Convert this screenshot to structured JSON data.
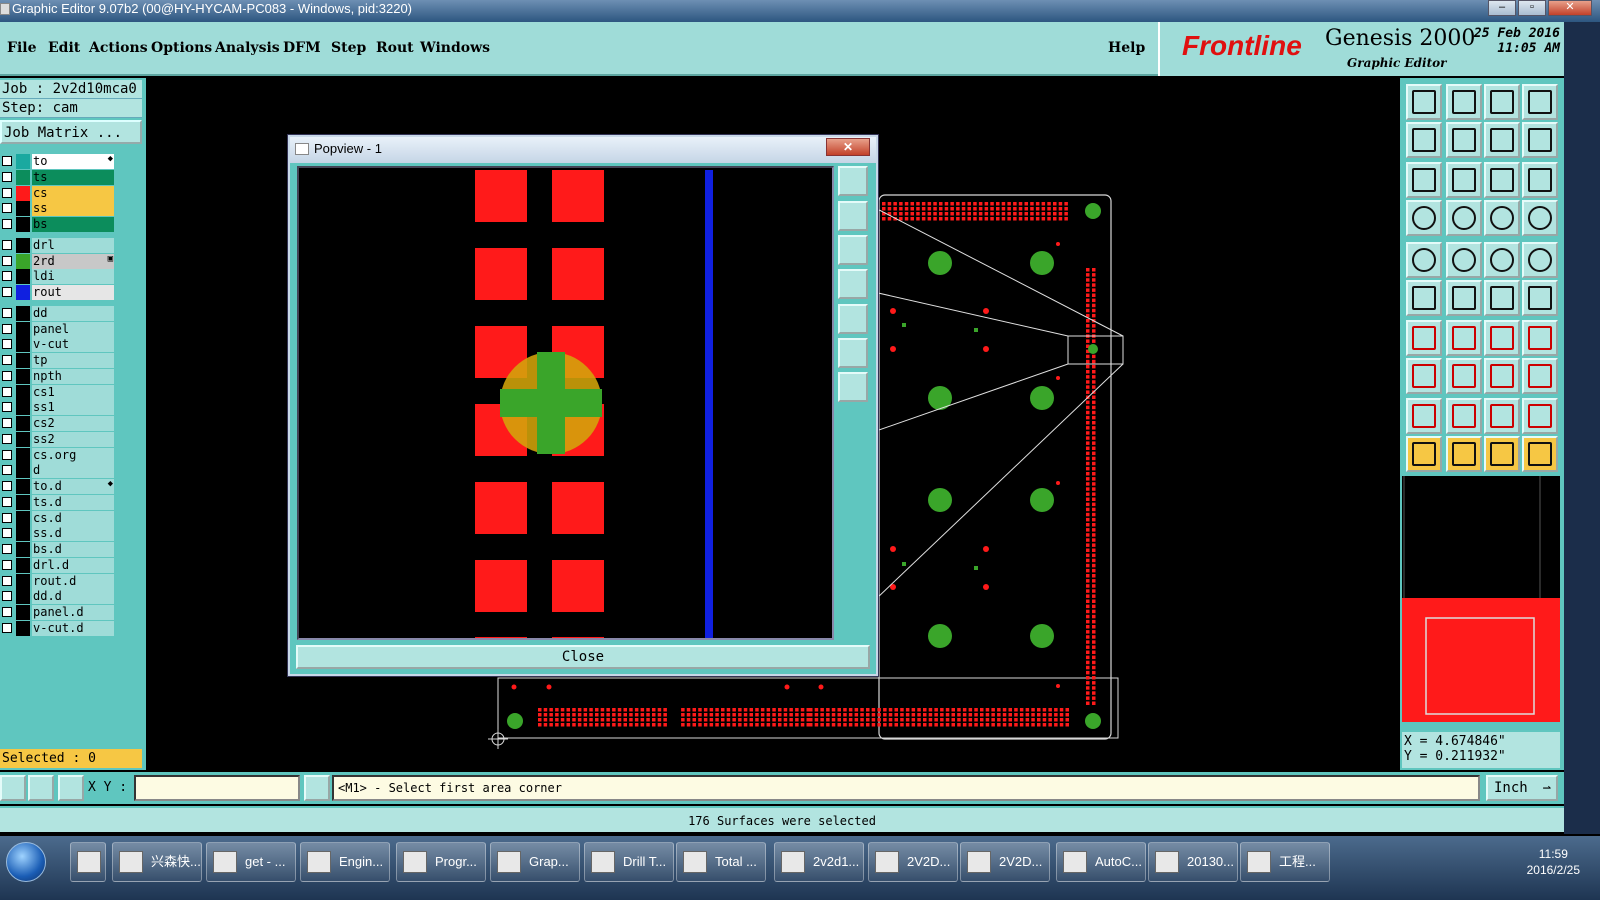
{
  "window": {
    "title": "Graphic Editor 9.07b2 (00@HY-HYCAM-PC083 - Windows, pid:3220)"
  },
  "menubar": {
    "items": [
      "File",
      "Edit",
      "Actions",
      "Options",
      "Analysis",
      "DFM",
      "Step",
      "Rout",
      "Windows"
    ],
    "help": "Help"
  },
  "brand": {
    "logo": "Frontline",
    "product": "Genesis 2000",
    "subtitle": "Graphic Editor",
    "date": "25 Feb 2016",
    "time": "11:05 AM"
  },
  "job": {
    "job_line": "Job : 2v2d10mca0",
    "step_line": "Step: cam",
    "matrix_button": "Job Matrix ..."
  },
  "layers": [
    {
      "name": "to",
      "color": "#1aa9a0",
      "bg": "#ffffff",
      "marker": "◆"
    },
    {
      "name": "ts",
      "color": "#0c8d5c",
      "bg": "#0c8d5c",
      "marker": ""
    },
    {
      "name": "cs",
      "color": "#ff1a1a",
      "bg": "#f6c744",
      "marker": ""
    },
    {
      "name": "ss",
      "color": "#000000",
      "bg": "#f6c744",
      "marker": ""
    },
    {
      "name": "bs",
      "color": "#000000",
      "bg": "#0c8d5c",
      "marker": ""
    },
    {
      "name": "drl",
      "color": "#000000",
      "bg": "#9fdcd8",
      "marker": ""
    },
    {
      "name": "2rd",
      "color": "#3aa52a",
      "bg": "#c8c8c8",
      "marker": "▣"
    },
    {
      "name": "ldi",
      "color": "#000000",
      "bg": "#9fdcd8",
      "marker": ""
    },
    {
      "name": "rout",
      "color": "#1020e0",
      "bg": "#e6e6e6",
      "marker": ""
    },
    {
      "name": "dd",
      "color": "#000000",
      "bg": "#9fdcd8",
      "marker": ""
    },
    {
      "name": "panel",
      "color": "#000000",
      "bg": "#9fdcd8",
      "marker": ""
    },
    {
      "name": "v-cut",
      "color": "#000000",
      "bg": "#9fdcd8",
      "marker": ""
    },
    {
      "name": "tp",
      "color": "#000000",
      "bg": "#9fdcd8",
      "marker": ""
    },
    {
      "name": "npth",
      "color": "#000000",
      "bg": "#9fdcd8",
      "marker": ""
    },
    {
      "name": "cs1",
      "color": "#000000",
      "bg": "#9fdcd8",
      "marker": ""
    },
    {
      "name": "ss1",
      "color": "#000000",
      "bg": "#9fdcd8",
      "marker": ""
    },
    {
      "name": "cs2",
      "color": "#000000",
      "bg": "#9fdcd8",
      "marker": ""
    },
    {
      "name": "ss2",
      "color": "#000000",
      "bg": "#9fdcd8",
      "marker": ""
    },
    {
      "name": "cs.org",
      "color": "#000000",
      "bg": "#9fdcd8",
      "marker": ""
    },
    {
      "name": "d",
      "color": "#000000",
      "bg": "#9fdcd8",
      "marker": ""
    },
    {
      "name": "to.d",
      "color": "#000000",
      "bg": "#9fdcd8",
      "marker": "◆"
    },
    {
      "name": "ts.d",
      "color": "#000000",
      "bg": "#9fdcd8",
      "marker": ""
    },
    {
      "name": "cs.d",
      "color": "#000000",
      "bg": "#9fdcd8",
      "marker": ""
    },
    {
      "name": "ss.d",
      "color": "#000000",
      "bg": "#9fdcd8",
      "marker": ""
    },
    {
      "name": "bs.d",
      "color": "#000000",
      "bg": "#9fdcd8",
      "marker": ""
    },
    {
      "name": "drl.d",
      "color": "#000000",
      "bg": "#9fdcd8",
      "marker": ""
    },
    {
      "name": "rout.d",
      "color": "#000000",
      "bg": "#9fdcd8",
      "marker": ""
    },
    {
      "name": "dd.d",
      "color": "#000000",
      "bg": "#9fdcd8",
      "marker": ""
    },
    {
      "name": "panel.d",
      "color": "#000000",
      "bg": "#9fdcd8",
      "marker": ""
    },
    {
      "name": "v-cut.d",
      "color": "#000000",
      "bg": "#9fdcd8",
      "marker": ""
    }
  ],
  "selected": "Selected : 0",
  "popview": {
    "title": "Popview - 1",
    "close_x": "✕",
    "close_button": "Close"
  },
  "coords": {
    "x": "X = 4.674846\"",
    "y": "Y = 0.211932\""
  },
  "bottom": {
    "xy_label": "X Y :",
    "xy_value": "",
    "prompt": "<M1> - Select first area corner",
    "units": "Inch",
    "units_arrow": "⇀"
  },
  "status": "176 Surfaces were selected",
  "taskbar": {
    "items": [
      "兴森快...",
      "get - ...",
      "Engin...",
      "Progr...",
      "Grap...",
      "Drill T...",
      "Total ...",
      "2v2d1...",
      "2V2D...",
      "2V2D...",
      "AutoC...",
      "20130...",
      "工程..."
    ],
    "time": "11:59",
    "date": "2016/2/25"
  },
  "colors": {
    "panel_teal": "#5fc6bf",
    "light_teal": "#b2e4e0",
    "pad_red": "#ff1a1a",
    "drill_green": "#3aa52a",
    "rout_blue": "#1020e0",
    "highlight_yellow": "#f6c744"
  }
}
